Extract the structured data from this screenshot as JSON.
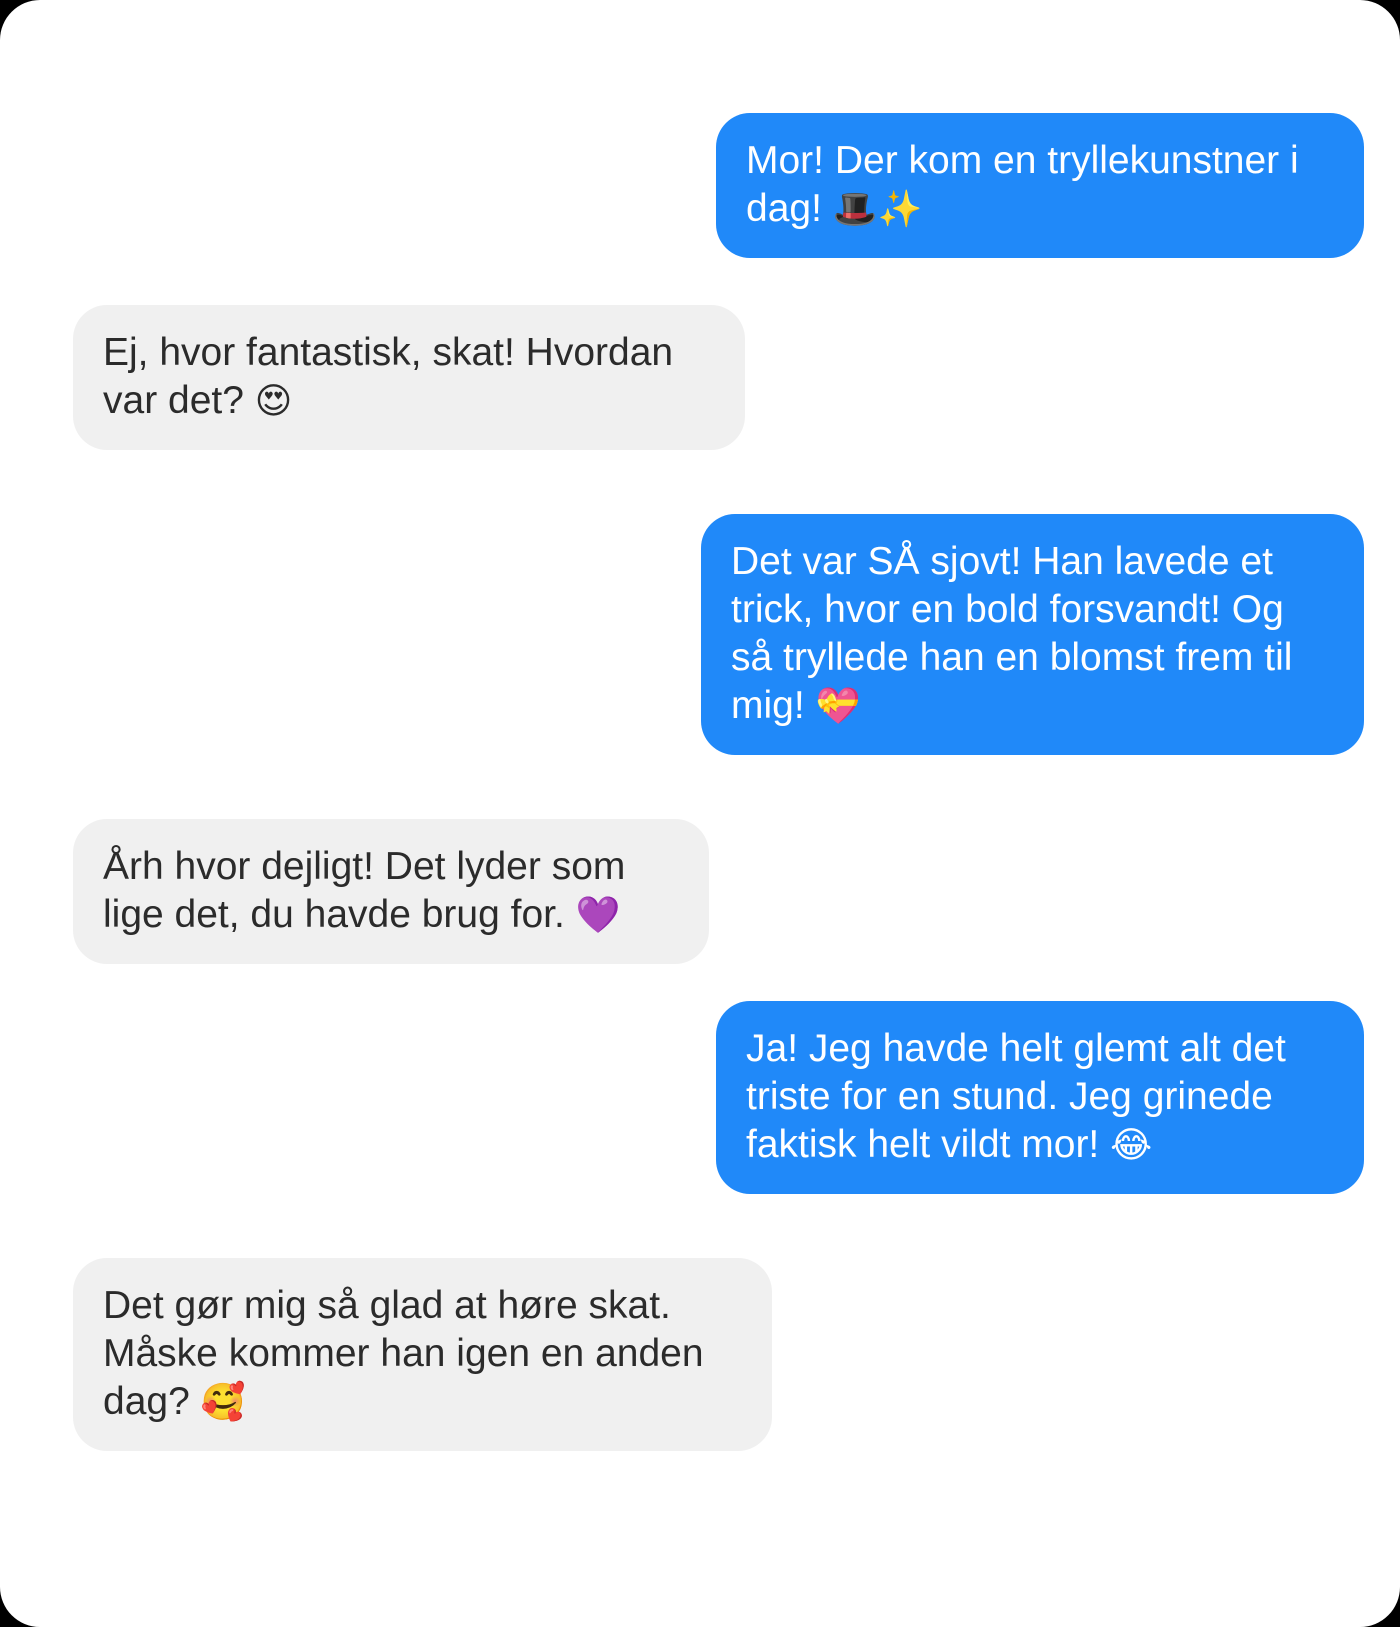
{
  "conversation": {
    "messages": [
      {
        "sender": "me",
        "text": "Mor! Der kom en tryllekunstner i dag!",
        "emoji": "🎩✨"
      },
      {
        "sender": "mother",
        "text": "Ej, hvor fantastisk, skat! Hvordan var det?",
        "emoji": "😍"
      },
      {
        "sender": "me",
        "text": "Det var SÅ sjovt! Han lavede et trick, hvor en bold forsvandt! Og så tryllede han en blomst frem til mig!",
        "emoji": "💝"
      },
      {
        "sender": "mother",
        "text": "Årh hvor dejligt! Det lyder som lige det, du havde brug for.",
        "emoji": "💜"
      },
      {
        "sender": "me",
        "text": "Ja! Jeg havde helt glemt alt det triste for en stund. Jeg grinede faktisk helt vildt mor!",
        "emoji": "😂"
      },
      {
        "sender": "mother",
        "text": "Det gør mig så glad at høre skat. Måske kommer han igen en anden dag?",
        "emoji": "🥰"
      }
    ]
  },
  "colors": {
    "sent_bubble": "#2089f9",
    "received_bubble": "#f0f0f0",
    "sent_text": "#ffffff",
    "received_text": "#2b2b2b"
  }
}
